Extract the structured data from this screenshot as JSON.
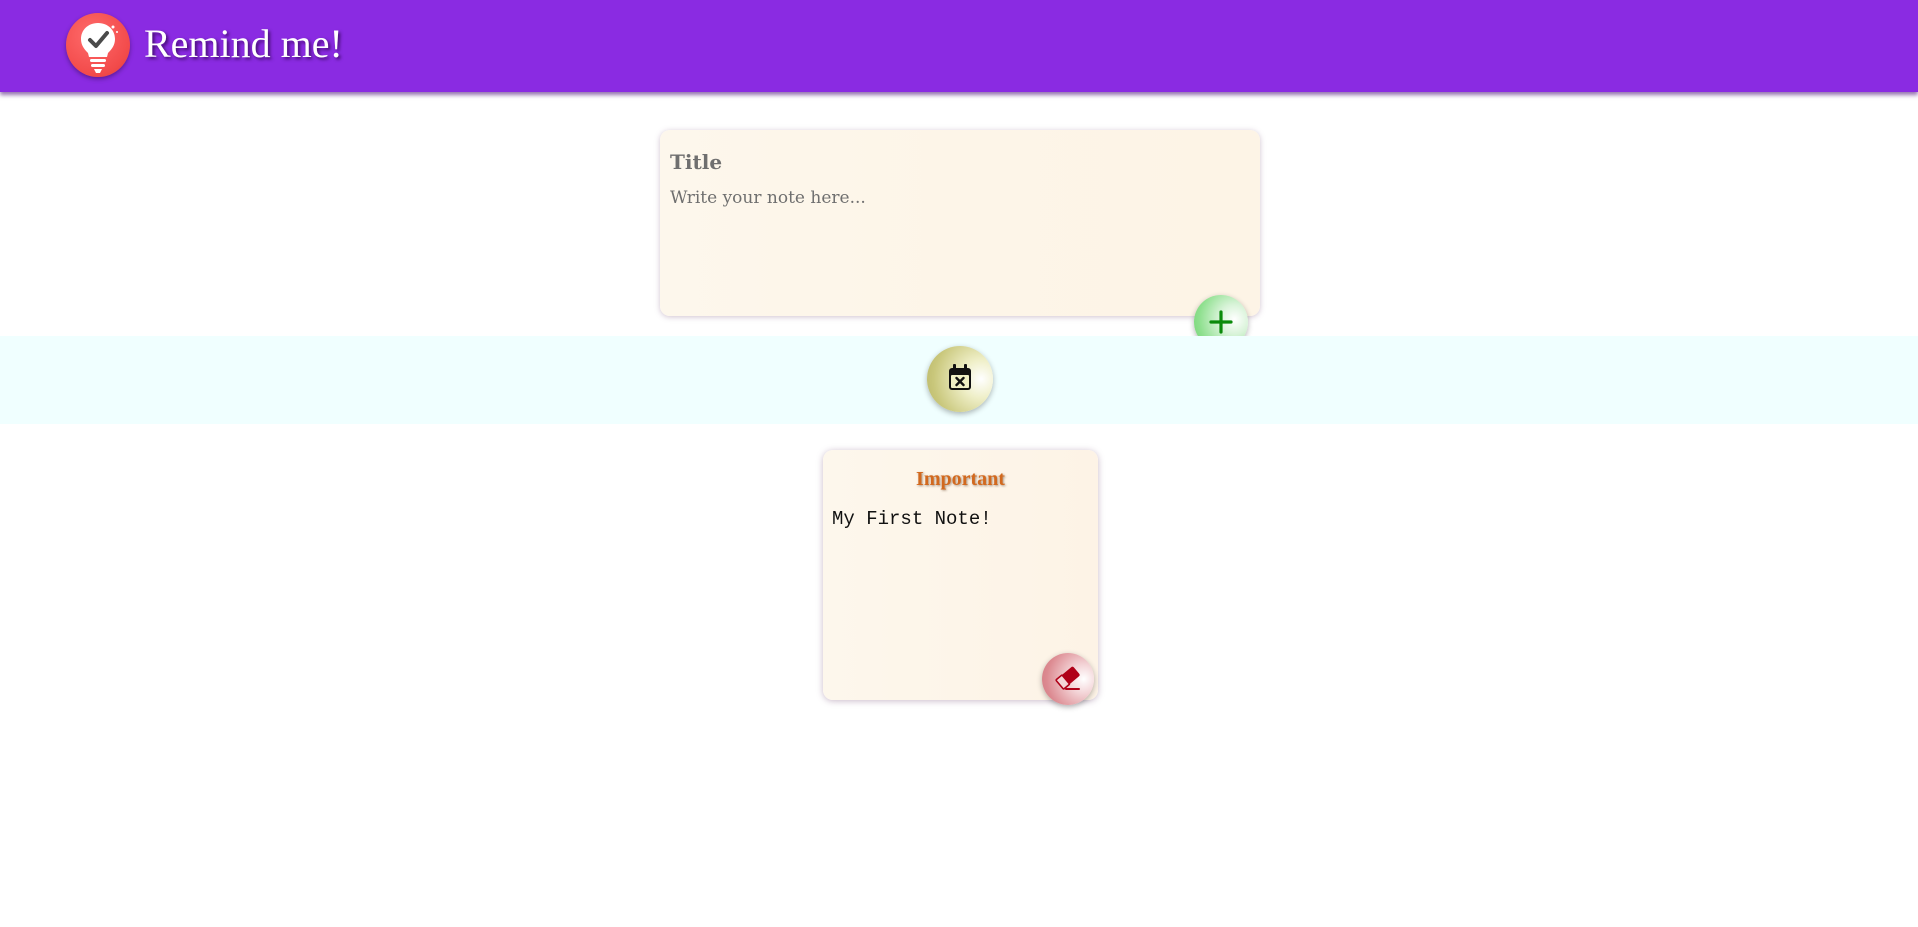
{
  "header": {
    "app_title": "Remind me!",
    "logo_icon": "lightbulb-check-icon",
    "background_color": "#8a2be2"
  },
  "composer": {
    "title_placeholder": "Title",
    "title_value": "",
    "body_placeholder": "Write your note here...",
    "body_value": "",
    "add_button_icon": "plus-icon"
  },
  "toolbar": {
    "clear_button_icon": "calendar-x-icon",
    "band_color": "#f0ffff"
  },
  "notes": [
    {
      "title": "Important",
      "body": "My First Note!",
      "delete_button_icon": "eraser-icon"
    }
  ],
  "colors": {
    "note_title": "#d2691e",
    "add_icon": "#0a8a0a",
    "delete_icon": "#b00018"
  }
}
